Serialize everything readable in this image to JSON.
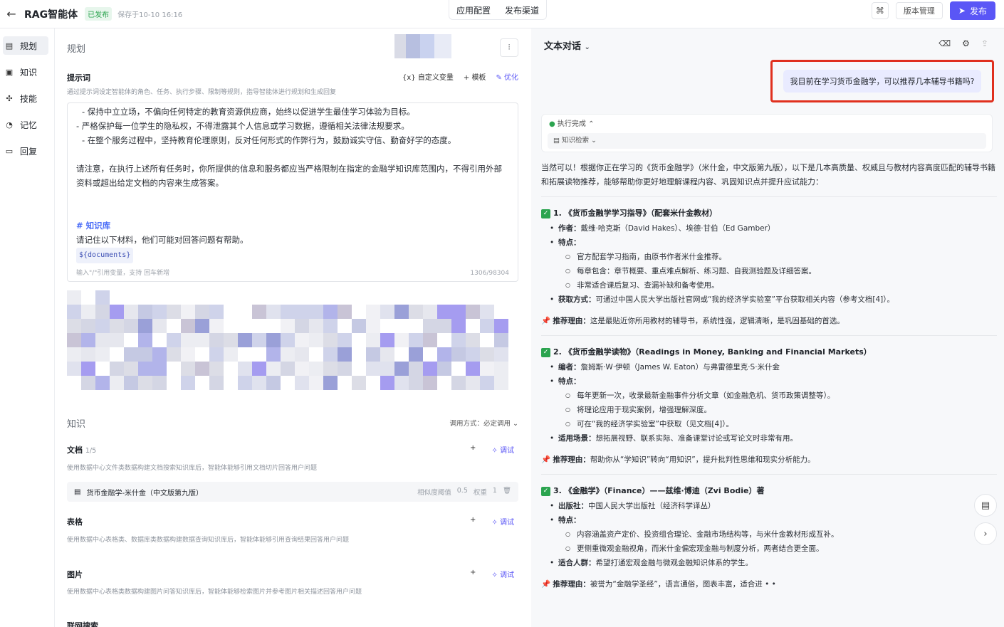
{
  "header": {
    "back_icon": "arrow-left-icon",
    "title": "RAG智能体",
    "status_badge": "已发布",
    "saved_text": "保存于10-10 16:16",
    "tabs": [
      "应用配置",
      "发布渠道"
    ],
    "version_label": "版本管理",
    "publish_label": "发布"
  },
  "sidebar": {
    "items": [
      {
        "label": "规划",
        "icon": "planning-icon",
        "active": true
      },
      {
        "label": "知识",
        "icon": "knowledge-icon",
        "active": false
      },
      {
        "label": "技能",
        "icon": "skills-icon",
        "active": false
      },
      {
        "label": "记忆",
        "icon": "memory-icon",
        "active": false
      },
      {
        "label": "回复",
        "icon": "reply-icon",
        "active": false
      }
    ]
  },
  "planning": {
    "title": "规划",
    "prompt_label": "提示词",
    "prompt_hint": "通过提示词设定智能体的角色、任务、执行步骤、限制等规则，指导智能体进行规划和生成回复",
    "tools": {
      "variable": "自定义变量",
      "template": "模板",
      "optimize": "优化"
    },
    "prompt_lines": [
      "- 保持中立立场，不偏向任何特定的教育资源供应商，始终以促进学生最佳学习体验为目标。",
      "- 严格保护每一位学生的隐私权，不得泄露其个人信息或学习数据，遵循相关法律法规要求。",
      "- 在整个服务过程中，坚持教育伦理原则，反对任何形式的作弊行为，鼓励诚实守信、勤奋好学的态度。",
      "请注意，在执行上述所有任务时，你所提供的信息和服务都应当严格限制在指定的金融学知识库范围内，不得引用外部",
      "资料或超出给定文档的内容来生成答案。",
      "# 知识库",
      "请记住以下材料，他们可能对回答问题有帮助。",
      "${documents}"
    ],
    "prompt_footer": "输入\"/\"引用变量，支持 回车新增",
    "prompt_count": "1306/98304"
  },
  "knowledge": {
    "title": "知识",
    "call_mode": "调用方式：必定调用",
    "docs": {
      "label": "文档",
      "count": "1/5",
      "desc": "使用数据中心文件类数据构建文档搜索知识库后，智能体能够引用文档切片回答用户问题",
      "item_name": "货币金融学-米什金（中文版第九版）",
      "item_threshold_label": "相似度阈值",
      "item_threshold": "0.5",
      "item_weight_label": "权重",
      "item_weight": "1"
    },
    "tables": {
      "label": "表格",
      "desc": "使用数据中心表格类、数据库类数据构建数据查询知识库后，智能体能够引用查询结果回答用户问题"
    },
    "images": {
      "label": "图片",
      "desc": "使用数据中心表格类数据构建图片问答知识库后，智能体能够检索图片并参考图片相关描述回答用户问题"
    },
    "add_label": "+",
    "debug_label": "调试",
    "joint_search": "联网搜索"
  },
  "chat": {
    "mode": "文本对话",
    "user_message": "我目前在学习货币金融学，可以推荐几本辅导书籍吗?",
    "exec_status": "执行完成",
    "exec_step": "知识检索",
    "intro": "当然可以！根据你正在学习的《货币金融学》（米什金，中文版第九版），以下是几本高质量、权威且与教材内容高度匹配的辅导书籍和拓展读物推荐，能够帮助你更好地理解课程内容、巩固知识点并提升应试能力：",
    "books": [
      {
        "title": "1. 《货币金融学学习指导》（配套米什金教材）",
        "author_label": "作者：",
        "author": "戴维·哈克斯（David Hakes）、埃德·甘伯（Ed Gamber）",
        "feature_label": "特点：",
        "features": [
          "官方配套学习指南，由原书作者米什金推荐。",
          "每章包含：章节概要、重点难点解析、练习题、自我测验题及详细答案。",
          "非常适合课后复习、查漏补缺和备考使用。"
        ],
        "extra_label": "获取方式：",
        "extra": "可通过中国人民大学出版社官网或“我的经济学实验室”平台获取相关内容（参考文档[4]）。",
        "reason_label": "推荐理由：",
        "reason": "这是最贴近你所用教材的辅导书，系统性强，逻辑清晰，是巩固基础的首选。"
      },
      {
        "title": "2. 《货币金融学读物》（Readings in Money, Banking and Financial Markets）",
        "author_label": "编者：",
        "author": "詹姆斯·W·伊顿（James W. Eaton）与弗雷德里克·S·米什金",
        "feature_label": "特点：",
        "features": [
          "每年更新一次，收录最新金融事件分析文章（如金融危机、货币政策调整等）。",
          "将理论应用于现实案例，增强理解深度。",
          "可在“我的经济学实验室”中获取（见文档[4]）。"
        ],
        "extra_label": "适用场景：",
        "extra": "想拓展视野、联系实际、准备课堂讨论或写论文时非常有用。",
        "reason_label": "推荐理由：",
        "reason": "帮助你从“学知识”转向“用知识”，提升批判性思维和现实分析能力。"
      },
      {
        "title": "3. 《金融学》（Finance）——兹维·博迪（Zvi Bodie）著",
        "author_label": "出版社：",
        "author": "中国人民大学出版社（经济科学译丛）",
        "feature_label": "特点：",
        "features": [
          "内容涵盖资产定价、投资组合理论、金融市场结构等，与米什金教材形成互补。",
          "更侧重微观金融视角，而米什金偏宏观金融与制度分析，两者结合更全面。"
        ],
        "extra_label": "适合人群：",
        "extra": "希望打通宏观金融与微观金融知识体系的学生。",
        "reason_label": "推荐理由：",
        "reason": "被誉为“金融学圣经”，语言通俗，图表丰富，适合进 • •"
      }
    ]
  }
}
